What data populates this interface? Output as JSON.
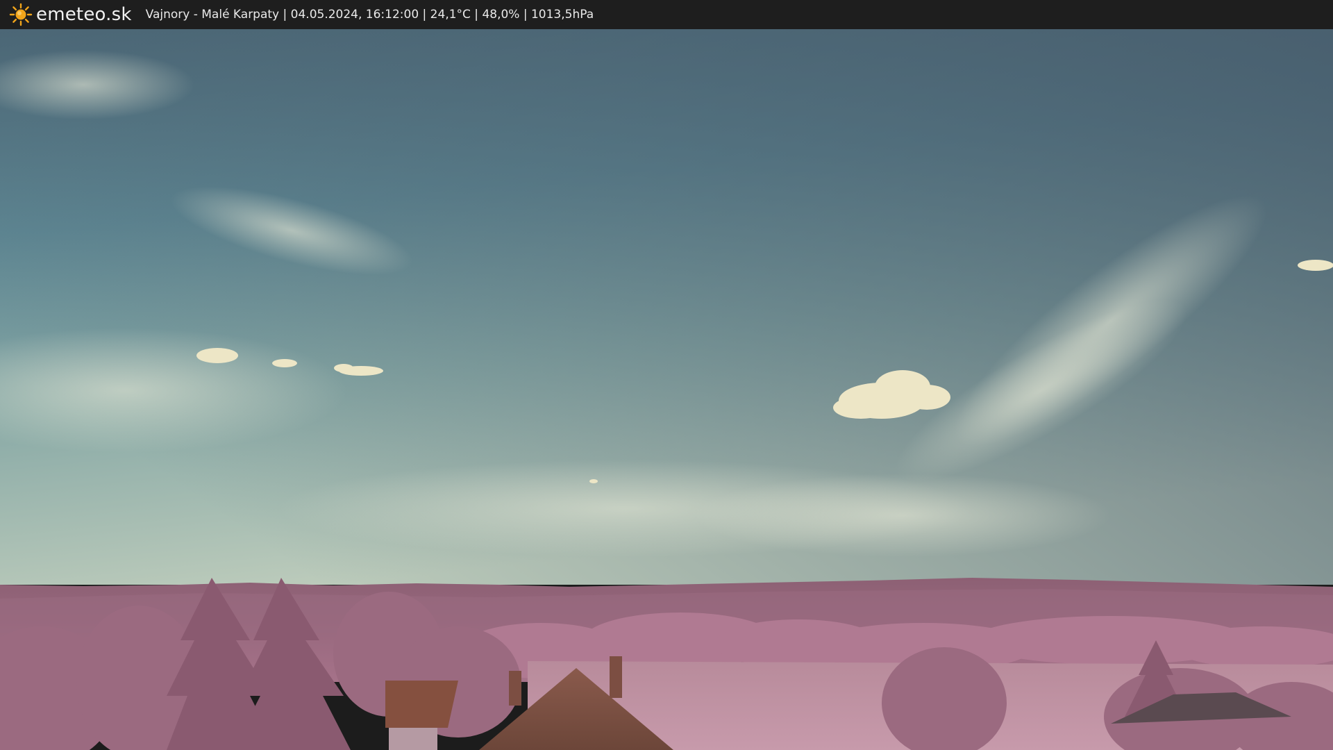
{
  "header": {
    "logo_icon": "sun-icon",
    "brand": "emeteo.sk",
    "info": "Vajnory - Malé Karpaty | 04.05.2024, 16:12:00 | 24,1°C | 48,0% | 1013,5hPa"
  },
  "colors": {
    "bar_background": "#1e1e1e",
    "sun": "#f2a51a",
    "sky_top": "#4f6e7c",
    "sky_bottom": "#b3c8bd",
    "vegetation": "#a56f86"
  }
}
